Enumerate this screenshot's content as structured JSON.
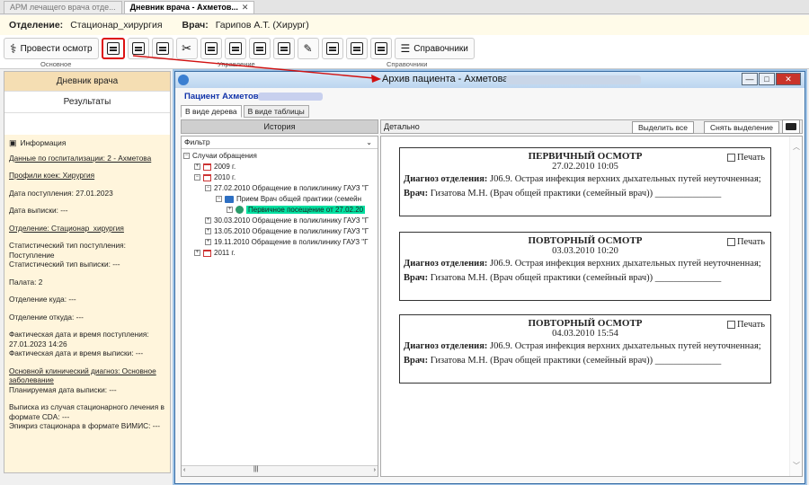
{
  "tabs": [
    {
      "label": "АРМ лечащего врача отде...",
      "active": false
    },
    {
      "label": "Дневник врача - Ахметов...",
      "active": true
    }
  ],
  "header": {
    "dept_label": "Отделение:",
    "dept_value": "Стационар_хирургия",
    "doctor_label": "Врач:",
    "doctor_value": "Гарипов А.Т. (Хирург)"
  },
  "ribbon": {
    "exam_button": "Провести осмотр",
    "references_button": "Справочники",
    "group_main": "Основное",
    "group_manage": "Управление",
    "group_refs": "Справочники"
  },
  "left": {
    "diary_button": "Дневник врача",
    "results_button": "Результаты",
    "info_title": "Информация",
    "lines": [
      "Данные по госпитализации: 2 - Ахметова",
      "Профили коек: Хирургия",
      "Дата поступления: 27.01.2023",
      "Дата выписки: ---",
      "Отделение: Стационар_хирургия",
      "Статистический тип поступления: Поступление",
      "Статистический тип выписки: ---",
      "Палата: 2",
      "Отделение куда: ---",
      "Отделение откуда: ---",
      "Фактическая дата и время поступления: 27.01.2023 14:26",
      "Фактическая дата и время выписки: ---",
      "Основной клинический диагноз: Основное заболевание",
      "Планируемая дата выписки: ---",
      "Выписка из случая стационарного лечения в формате CDA: ---",
      "Эпикриз стационара в формате ВИМИС: ---"
    ]
  },
  "window": {
    "title": "Архив пациента - Ахметова",
    "patient_label": "Пациент  Ахметова",
    "view_tree": "В виде дерева",
    "view_table": "В виде таблицы",
    "history_header": "История",
    "detail_header": "Детально",
    "select_all": "Выделить все",
    "deselect": "Снять выделение",
    "filter": "Фильтр",
    "tree": {
      "root": "Случаи обращения",
      "y2009": "2009 г.",
      "y2010": "2010 г.",
      "case1": "27.02.2010 Обращение в поликлинику ГАУЗ \"Г",
      "visit": "Прием Врач общей практики (семейн",
      "first": "Первичное посещение от 27.02.20",
      "case2": "30.03.2010 Обращение в поликлинику ГАУЗ \"Г",
      "case3": "13.05.2010 Обращение в поликлинику ГАУЗ \"Г",
      "case4": "19.11.2010 Обращение в поликлинику ГАУЗ \"Г",
      "y2011": "2011 г."
    },
    "cards": [
      {
        "title": "ПЕРВИЧНЫЙ ОСМОТР",
        "date": "27.02.2010 10:05",
        "dx_label": "Диагноз отделения:",
        "dx": " J06.9. Острая инфекция верхних дыхательных путей неуточненная;",
        "doc_label": "Врач:",
        "doc": " Гизатова М.Н. (Врач общей практики (семейный врач)) ______________",
        "print": "Печать"
      },
      {
        "title": "ПОВТОРНЫЙ ОСМОТР",
        "date": "03.03.2010 10:20",
        "dx_label": "Диагноз отделения:",
        "dx": " J06.9. Острая инфекция верхних дыхательных путей неуточненная;",
        "doc_label": "Врач:",
        "doc": " Гизатова М.Н. (Врач общей практики (семейный врач)) ______________",
        "print": "Печать"
      },
      {
        "title": "ПОВТОРНЫЙ ОСМОТР",
        "date": "04.03.2010 15:54",
        "dx_label": "Диагноз отделения:",
        "dx": " J06.9. Острая инфекция верхних дыхательных путей неуточненная;",
        "doc_label": "Врач:",
        "doc": " Гизатова М.Н. (Врач общей практики (семейный врач)) ______________",
        "print": "Печать"
      }
    ]
  },
  "colors": {
    "accent_red": "#d11111",
    "highlight": "#00e0a0",
    "info_bg": "#fff5dc"
  },
  "icons": [
    "stethoscope-plus-icon",
    "archive-icon",
    "document-icon",
    "printer-icon",
    "calendar-icon",
    "folder-icon",
    "person-icon"
  ]
}
